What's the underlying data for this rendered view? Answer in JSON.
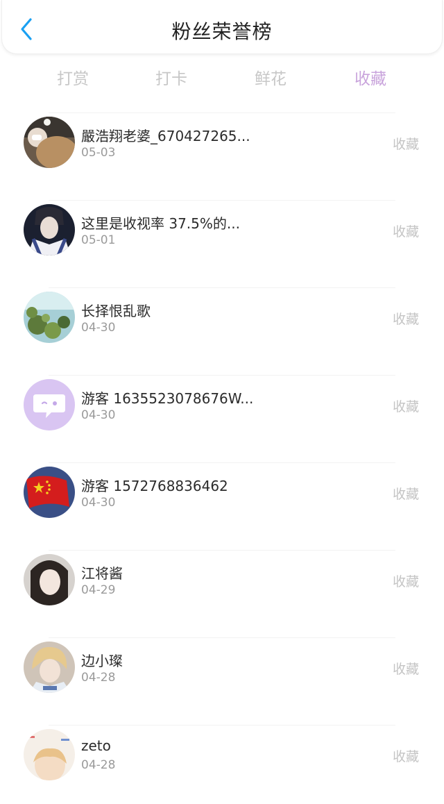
{
  "header": {
    "title": "粉丝荣誉榜",
    "back_icon": "chevron-left-icon",
    "accent": "#1aa0f2"
  },
  "tabs": [
    {
      "label": "打赏",
      "active": false
    },
    {
      "label": "打卡",
      "active": false
    },
    {
      "label": "鲜花",
      "active": false
    },
    {
      "label": "收藏",
      "active": true
    }
  ],
  "list": [
    {
      "name": "嚴浩翔老婆_670427265...",
      "date": "05-03",
      "action": "收藏"
    },
    {
      "name": "这里是收视率 37.5%的...",
      "date": "05-01",
      "action": "收藏"
    },
    {
      "name": "长择恨乱歌",
      "date": "04-30",
      "action": "收藏"
    },
    {
      "name": "游客 1635523078676W...",
      "date": "04-30",
      "action": "收藏"
    },
    {
      "name": "游客 1572768836462",
      "date": "04-30",
      "action": "收藏"
    },
    {
      "name": "江将酱",
      "date": "04-29",
      "action": "收藏"
    },
    {
      "name": "边小璨",
      "date": "04-28",
      "action": "收藏"
    },
    {
      "name": "zeto",
      "date": "04-28",
      "action": "收藏"
    }
  ]
}
